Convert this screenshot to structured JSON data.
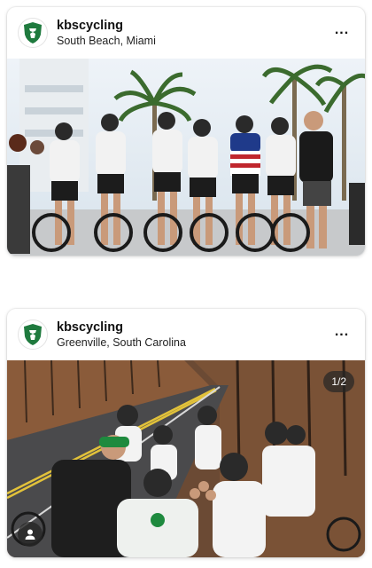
{
  "posts": [
    {
      "username": "kbscycling",
      "location": "South Beach, Miami",
      "more_icon": "more-horizontal-icon"
    },
    {
      "username": "kbscycling",
      "location": "Greenville, South Carolina",
      "counter": "1/2",
      "more_icon": "more-horizontal-icon",
      "tag_icon": "user-tag-icon"
    }
  ],
  "colors": {
    "logo_green": "#1f7a3e",
    "badge_bg": "#262626"
  }
}
